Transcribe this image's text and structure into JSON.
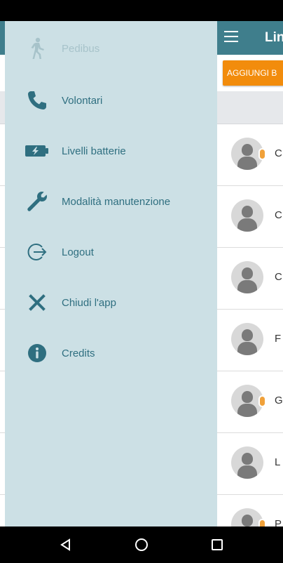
{
  "drawer": {
    "items": [
      {
        "label": "Pedibus",
        "icon": "pedestrian-icon",
        "disabled": true
      },
      {
        "label": "Volontari",
        "icon": "phone-icon"
      },
      {
        "label": "Livelli batterie",
        "icon": "battery-icon"
      },
      {
        "label": "Modalità manutenzione",
        "icon": "wrench-icon"
      },
      {
        "label": "Logout",
        "icon": "logout-icon"
      },
      {
        "label": "Chiudi l'app",
        "icon": "close-icon"
      },
      {
        "label": "Credits",
        "icon": "info-icon"
      }
    ]
  },
  "toolbar": {
    "title": "Lin"
  },
  "add_button": {
    "label": "AGGIUNGI B"
  },
  "list": {
    "rows": [
      {
        "initial": "C",
        "badge": true
      },
      {
        "initial": "C",
        "badge": false
      },
      {
        "initial": "C",
        "badge": false
      },
      {
        "initial": "F",
        "badge": false
      },
      {
        "initial": "G",
        "badge": true
      },
      {
        "initial": "L",
        "badge": false
      },
      {
        "initial": "P",
        "badge": true
      }
    ]
  },
  "colors": {
    "toolbar": "#3f7e8c",
    "drawer_bg": "#cce0e5",
    "drawer_text": "#2f6f80",
    "accent_orange": "#f28c0c"
  }
}
